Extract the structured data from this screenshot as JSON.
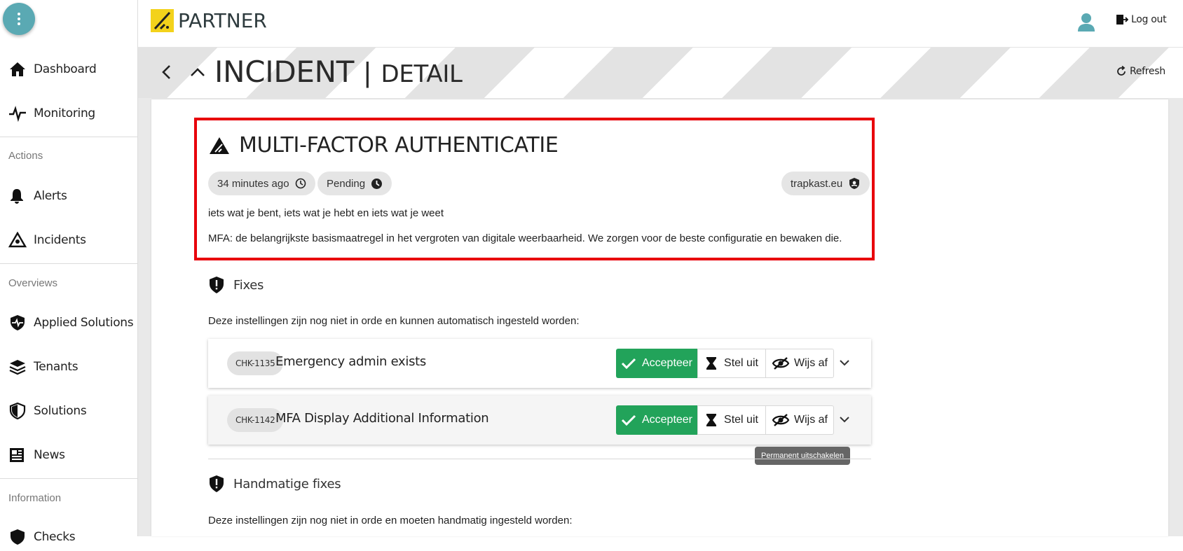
{
  "app": {
    "name": "PARTNER",
    "logout_label": "Log out"
  },
  "sidebar": {
    "items": [
      {
        "label": "Dashboard",
        "icon": "home-icon"
      },
      {
        "label": "Monitoring",
        "icon": "pulse-icon"
      }
    ],
    "sections": [
      {
        "title": "Actions",
        "items": [
          {
            "label": "Alerts",
            "icon": "bell-icon"
          },
          {
            "label": "Incidents",
            "icon": "incident-icon"
          }
        ]
      },
      {
        "title": "Overviews",
        "items": [
          {
            "label": "Applied Solutions",
            "icon": "shield-pulse-icon"
          },
          {
            "label": "Tenants",
            "icon": "layers-icon"
          },
          {
            "label": "Solutions",
            "icon": "shield-icon"
          },
          {
            "label": "News",
            "icon": "newspaper-icon"
          }
        ]
      },
      {
        "title": "Information",
        "items": [
          {
            "label": "Checks",
            "icon": "shield-check-icon"
          }
        ]
      }
    ]
  },
  "header": {
    "title": "INCIDENT",
    "separator": "|",
    "subtitle": "DETAIL",
    "refresh_label": "Refresh"
  },
  "incident": {
    "title": "MULTI-FACTOR AUTHENTICATIE",
    "time_chip": "34 minutes ago",
    "status_chip": "Pending",
    "tenant_chip": "trapkast.eu",
    "tagline": "iets wat je bent, iets wat je hebt en iets wat je weet",
    "description": "MFA: de belangrijkste basismaatregel in het vergroten van digitale weerbaarheid. We zorgen voor de beste configuratie en bewaken die."
  },
  "fixes": {
    "title": "Fixes",
    "intro": "Deze instellingen zijn nog niet in orde en kunnen automatisch ingesteld worden:",
    "rows": [
      {
        "code": "CHK-1135",
        "name": "Emergency admin exists"
      },
      {
        "code": "CHK-1142",
        "name": "MFA Display Additional Information"
      }
    ],
    "accept_label": "Accepteer",
    "snooze_label": "Stel uit",
    "reject_label": "Wijs af",
    "tooltip": "Permanent uitschakelen"
  },
  "manual_fixes": {
    "title": "Handmatige fixes",
    "intro": "Deze instellingen zijn nog niet in orde en moeten handmatig ingesteld worden:"
  },
  "colors": {
    "accent": "#5aa9b3",
    "brand_yellow": "#f3d21b",
    "accept_green": "#22a35a",
    "highlight_red": "#e8000b"
  }
}
